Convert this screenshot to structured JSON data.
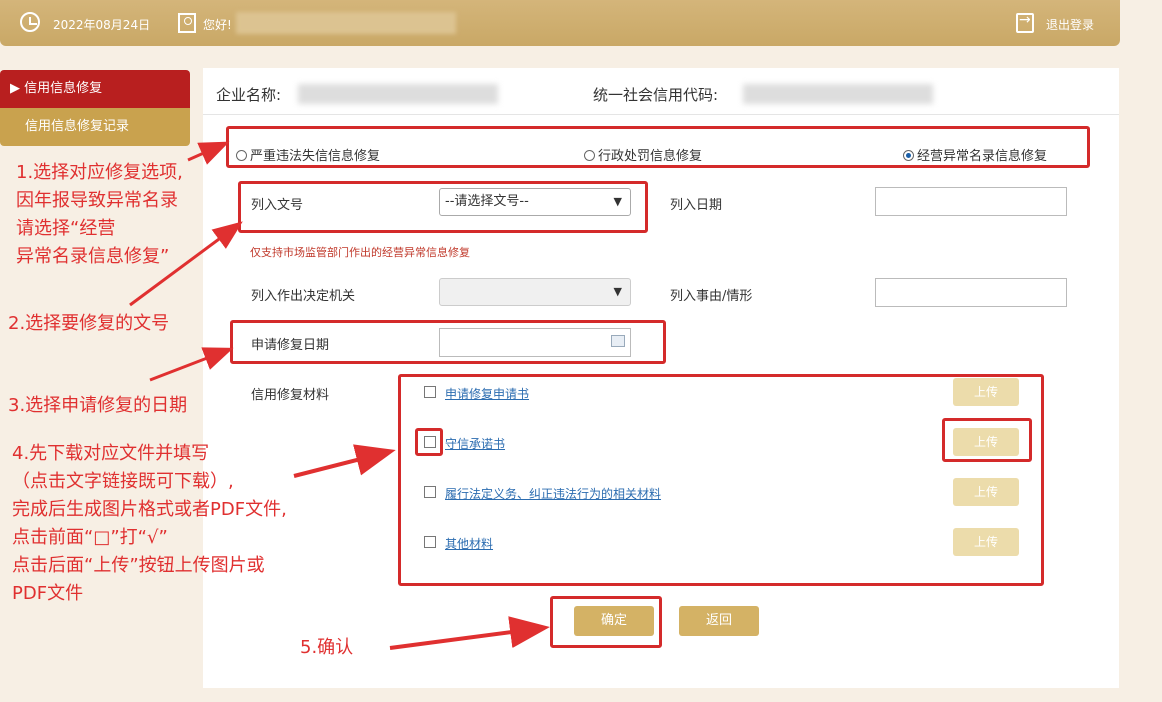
{
  "header": {
    "date": "2022年08月24日",
    "greeting": "您好!",
    "logout": "退出登录"
  },
  "sidebar": {
    "items": [
      {
        "label": "▶ 信用信息修复"
      },
      {
        "label": "信用信息修复记录"
      }
    ]
  },
  "form": {
    "company_label": "企业名称:",
    "credit_code_label": "统一社会信用代码:",
    "radios": [
      {
        "label": "严重违法失信信息修复",
        "selected": false
      },
      {
        "label": "行政处罚信息修复",
        "selected": false
      },
      {
        "label": "经营异常名录信息修复",
        "selected": true
      }
    ],
    "list_doc_label": "列入文号",
    "list_doc_select": "--请选择文号--",
    "list_date_label": "列入日期",
    "note": "仅支持市场监管部门作出的经营异常信息修复",
    "authority_label": "列入作出决定机关",
    "reason_label": "列入事由/情形",
    "apply_date_label": "申请修复日期",
    "materials_label": "信用修复材料",
    "materials": [
      {
        "label": "申请修复申请书",
        "upload": "上传"
      },
      {
        "label": "守信承诺书",
        "upload": "上传"
      },
      {
        "label": "履行法定义务、纠正违法行为的相关材料",
        "upload": "上传"
      },
      {
        "label": "其他材料",
        "upload": "上传"
      }
    ],
    "confirm": "确定",
    "back": "返回"
  },
  "annotations": {
    "step1": [
      "1.选择对应修复选项,",
      "因年报导致异常名录",
      "请选择“经营",
      "异常名录信息修复”"
    ],
    "step2": "2.选择要修复的文号",
    "step3": "3.选择申请修复的日期",
    "step4": [
      "4.先下载对应文件并填写",
      "（点击文字链接既可下载）,",
      "完成后生成图片格式或者PDF文件,",
      "点击前面“□”打“√”",
      "点击后面“上传”按钮上传图片或",
      " PDF文件"
    ],
    "step5": "5.确认"
  },
  "colors": {
    "header": "#c9a866",
    "active_nav": "#b81f1f",
    "annotation": "#e03030"
  }
}
